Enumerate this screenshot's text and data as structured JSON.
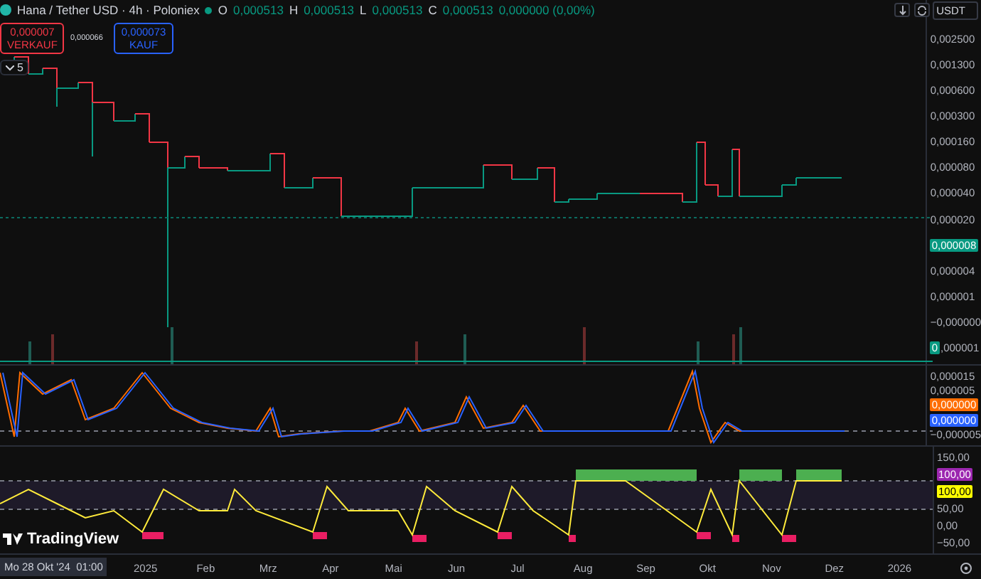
{
  "symbol": {
    "title": "Hana / Tether USD · 4h · Poloniex",
    "market_open": true,
    "ohlc": [
      {
        "label": "O",
        "value": "0,000513"
      },
      {
        "label": "H",
        "value": "0,000513"
      },
      {
        "label": "L",
        "value": "0,000513"
      },
      {
        "label": "C",
        "value": "0,000513"
      }
    ],
    "change": "0,000000 (0,00%)"
  },
  "trade": {
    "sell": {
      "price": "0,000007",
      "label": "VERKAUF"
    },
    "spread": "0,000066",
    "buy": {
      "price": "0,000073",
      "label": "KAUF"
    }
  },
  "indicators": {
    "count": "5"
  },
  "currency": "USDT",
  "panes": [
    {
      "kind": "price",
      "rows": [
        [
          {
            "kind": "label",
            "text": "0,002500"
          }
        ],
        [
          {
            "kind": "label",
            "text": "0,001300"
          }
        ],
        [
          {
            "kind": "label",
            "text": "0,000600"
          }
        ],
        [
          {
            "kind": "label",
            "text": "0,000300"
          }
        ],
        [
          {
            "kind": "label",
            "text": "0,000160"
          }
        ],
        [
          {
            "kind": "label",
            "text": "0,000080"
          }
        ],
        [
          {
            "kind": "label",
            "text": "0,000040"
          }
        ],
        [
          {
            "kind": "label",
            "text": "0,000020"
          }
        ],
        [
          {
            "kind": "tag",
            "text": "0,000008",
            "color": "#089981"
          }
        ],
        [
          {
            "kind": "label",
            "text": "0,000004"
          }
        ],
        [
          {
            "kind": "label",
            "text": "0,000001"
          }
        ],
        [
          {
            "kind": "label",
            "text": "−0,000000"
          }
        ],
        [
          {
            "kind": "tag",
            "text": "0",
            "color": "#089981"
          },
          {
            "kind": "label",
            "text": ",000001"
          }
        ]
      ]
    },
    {
      "kind": "oscillator",
      "rows": [
        [
          {
            "kind": "label",
            "text": "0,000015"
          }
        ],
        [
          {
            "kind": "label",
            "text": "0,000005"
          }
        ],
        [
          {
            "kind": "tag",
            "text": "0,000000",
            "color": "#ff6d00"
          }
        ],
        [
          {
            "kind": "tag",
            "text": "0,000000",
            "color": "#2962ff"
          }
        ],
        [
          {
            "kind": "label",
            "text": "−0,000005"
          }
        ]
      ]
    },
    {
      "kind": "band",
      "rows": [
        [
          {
            "kind": "label",
            "text": "150,00"
          }
        ],
        [
          {
            "kind": "tag",
            "text": "100,00",
            "color": "#9c27b0"
          }
        ],
        [
          {
            "kind": "tag",
            "text": "100,00",
            "color": "#ffff00"
          }
        ],
        [
          {
            "kind": "label",
            "text": "50,00"
          }
        ],
        [
          {
            "kind": "label",
            "text": "0,00"
          }
        ],
        [
          {
            "kind": "label",
            "text": "−50,00"
          }
        ]
      ]
    }
  ],
  "time_axis": {
    "crosshair": "Mo 28 Okt '24  01:00",
    "ticks": [
      "2025",
      "Feb",
      "Mrz",
      "Apr",
      "Mai",
      "Jun",
      "Jul",
      "Aug",
      "Sep",
      "Okt",
      "Nov",
      "Dez",
      "2026"
    ]
  },
  "brand": "TradingView"
}
